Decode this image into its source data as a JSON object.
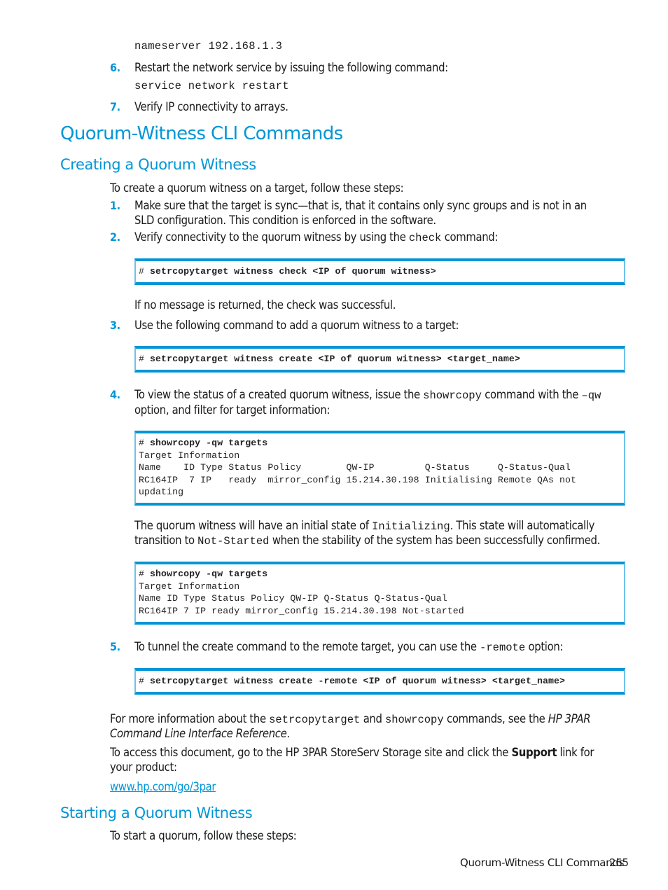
{
  "top": {
    "code_nameserver": "nameserver 192.168.1.3",
    "step6": {
      "num": "6.",
      "text": "Restart the network service by issuing the following command:",
      "code": "service network restart"
    },
    "step7": {
      "num": "7.",
      "text": "Verify IP connectivity to arrays."
    }
  },
  "section": {
    "title": "Quorum-Witness CLI Commands"
  },
  "creating": {
    "title": "Creating a Quorum Witness",
    "intro": "To create a quorum witness on a target, follow these steps:",
    "step1": {
      "num": "1.",
      "line1": "Make sure that the target is sync—that is, that it contains only sync groups and is not in an",
      "line2": "SLD configuration. This condition is enforced in the software."
    },
    "step2": {
      "num": "2.",
      "pre": "Verify connectivity to the quorum witness by using the ",
      "code": "check",
      "post": " command:"
    },
    "code1": {
      "prompt": "# ",
      "cmd": "setrcopytarget witness check <IP of quorum witness>"
    },
    "check_result": "If no message is returned, the check was successful.",
    "step3": {
      "num": "3.",
      "text": "Use the following command to add a quorum witness to a target:"
    },
    "code2": {
      "prompt": "# ",
      "cmd": "setrcopytarget witness create <IP of quorum witness> <target_name>"
    },
    "step4": {
      "num": "4.",
      "pre": "To view the status of a created quorum witness, issue the ",
      "code": "showrcopy",
      "mid": " command with the ",
      "code2": "–qw",
      "line2": "option, and filter for target information:"
    },
    "code3": {
      "prompt": "# ",
      "cmd": "showrcopy -qw targets",
      "lines": [
        "Target Information",
        "Name    ID Type Status Policy        QW-IP         Q-Status     Q-Status-Qual",
        "RC164IP  7 IP   ready  mirror_config 15.214.30.198 Initialising Remote QAs not",
        "updating"
      ]
    },
    "state_para": {
      "pre": "The quorum witness will have an initial state of ",
      "code1": "Initializing",
      "mid": ". This state will automatically",
      "line2_pre": "transition to ",
      "code2": "Not-Started",
      "line2_post": " when the stability of the system has been successfully confirmed."
    },
    "code4": {
      "prompt": "# ",
      "cmd": "showrcopy -qw targets",
      "lines": [
        "Target Information",
        "Name ID Type Status Policy QW-IP Q-Status Q-Status-Qual",
        "RC164IP 7 IP ready mirror_config 15.214.30.198 Not-started"
      ]
    },
    "step5": {
      "num": "5.",
      "pre": "To tunnel the create command to the remote target, you can use the ",
      "code": "-remote",
      "post": " option:"
    },
    "code5": {
      "prompt": "# ",
      "cmd": "setrcopytarget witness create -remote <IP of quorum witness> <target_name>"
    },
    "more_info": {
      "pre": "For more information about the ",
      "code1": "setrcopytarget",
      "mid": " and ",
      "code2": "showrcopy",
      "post": " commands, see the ",
      "ref1": "HP 3PAR",
      "ref2": "Command Line Interface Reference",
      "end": "."
    },
    "access": {
      "pre": "To access this document, go to the HP 3PAR StoreServ Storage site and click the ",
      "bold": "Support",
      "post": " link for",
      "line2": "your product:"
    },
    "link": "www.hp.com/go/3par"
  },
  "starting": {
    "title": "Starting a Quorum Witness",
    "intro": "To start a quorum, follow these steps:"
  },
  "footer": {
    "section": "Quorum-Witness CLI Commands",
    "page": "265"
  },
  "colors": {
    "accent": "#0096d6",
    "text": "#1a1a1a"
  }
}
